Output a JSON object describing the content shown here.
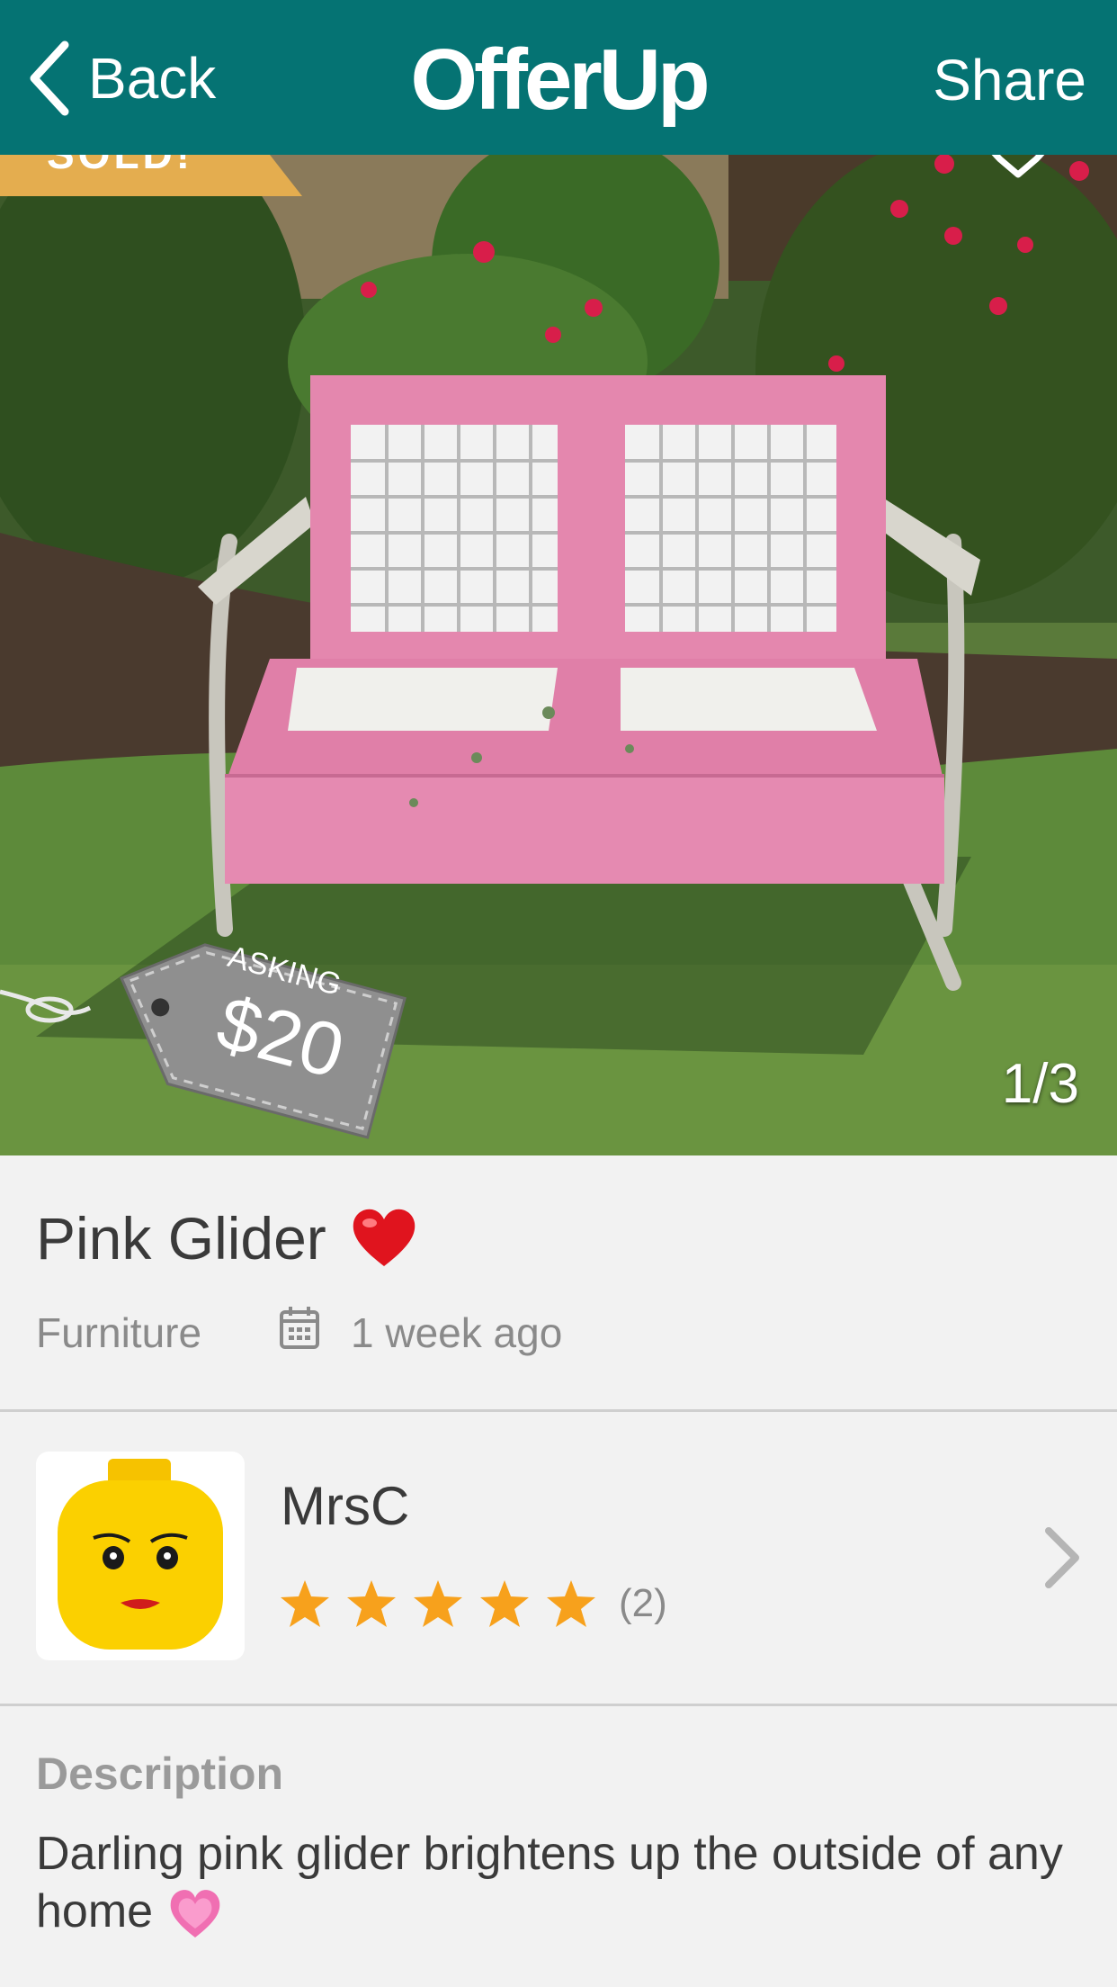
{
  "nav": {
    "back_label": "Back",
    "brand": "OfferUp",
    "share_label": "Share"
  },
  "photo": {
    "page_indicator": "1/3",
    "price_tag": {
      "asking_label": "ASKING",
      "price": "$20"
    }
  },
  "listing": {
    "title": "Pink Glider",
    "category": "Furniture",
    "posted": "1 week ago"
  },
  "seller": {
    "name": "MrsC",
    "rating_stars": 5,
    "rating_count": "(2)"
  },
  "description": {
    "heading": "Description",
    "text": "Darling pink glider brightens up the outside of any home"
  },
  "colors": {
    "nav_bg": "#057373",
    "star": "#f7a11c",
    "sold_banner": "#e4ad4f"
  }
}
